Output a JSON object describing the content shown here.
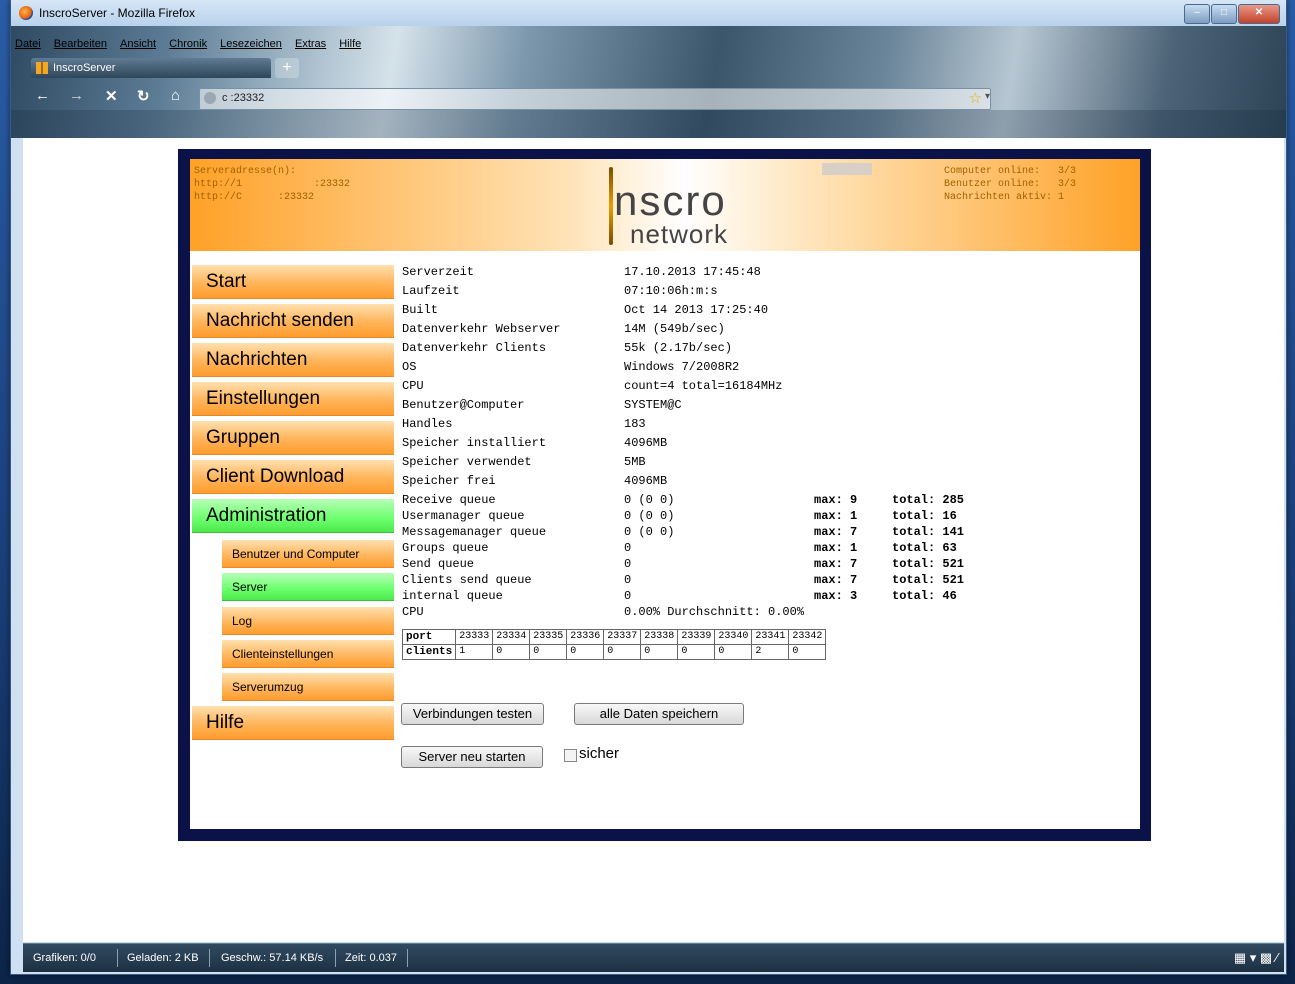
{
  "window": {
    "title": "InscroServer - Mozilla Firefox"
  },
  "menu": [
    "Datei",
    "Bearbeiten",
    "Ansicht",
    "Chronik",
    "Lesezeichen",
    "Extras",
    "Hilfe"
  ],
  "tab": {
    "label": "InscroServer",
    "new_tab": "+"
  },
  "urlbar": {
    "url": "c    :23332"
  },
  "header": {
    "left_lines": "Serveradresse(n):\nhttp://1            :23332\nhttp://C      :23332",
    "right_lines": "Computer online:   3/3\nBenutzer online:   3/3\nNachrichten aktiv: 1",
    "logo_line1": "nscro",
    "logo_line2": "network"
  },
  "nav": {
    "items": [
      {
        "label": "Start"
      },
      {
        "label": "Nachricht senden"
      },
      {
        "label": "Nachrichten"
      },
      {
        "label": "Einstellungen"
      },
      {
        "label": "Gruppen"
      },
      {
        "label": "Client Download"
      },
      {
        "label": "Administration"
      }
    ],
    "sub_items": [
      {
        "label": "Benutzer und Computer"
      },
      {
        "label": "Server"
      },
      {
        "label": "Log"
      },
      {
        "label": "Clienteinstellungen"
      },
      {
        "label": "Serverumzug"
      }
    ],
    "help": "Hilfe"
  },
  "info": [
    {
      "key": "Serverzeit",
      "value": "17.10.2013 17:45:48"
    },
    {
      "key": "Laufzeit",
      "value": "07:10:06h:m:s"
    },
    {
      "key": "Built",
      "value": "Oct 14 2013 17:25:40"
    },
    {
      "key": "Datenverkehr Webserver",
      "value": "14M (549b/sec)"
    },
    {
      "key": "Datenverkehr Clients",
      "value": "55k (2.17b/sec)"
    },
    {
      "key": "OS",
      "value": "Windows 7/2008R2"
    },
    {
      "key": "CPU",
      "value": "count=4 total=16184MHz"
    },
    {
      "key": "Benutzer@Computer",
      "value": "SYSTEM@C"
    },
    {
      "key": "Handles",
      "value": "183"
    },
    {
      "key": "Speicher installiert",
      "value": "4096MB"
    },
    {
      "key": "Speicher verwendet",
      "value": "5MB"
    },
    {
      "key": "Speicher frei",
      "value": "4096MB"
    }
  ],
  "queues": [
    {
      "key": "Receive queue",
      "value": "0 (0 0)",
      "max": "max: 9",
      "total": "total: 285"
    },
    {
      "key": "Usermanager queue",
      "value": "0 (0 0)",
      "max": "max: 1",
      "total": "total: 16"
    },
    {
      "key": "Messagemanager queue",
      "value": "0 (0 0)",
      "max": "max: 7",
      "total": "total: 141"
    },
    {
      "key": "Groups queue",
      "value": "0",
      "max": "max: 1",
      "total": "total: 63"
    },
    {
      "key": "Send queue",
      "value": "0",
      "max": "max: 7",
      "total": "total: 521"
    },
    {
      "key": "Clients send queue",
      "value": "0",
      "max": "max: 7",
      "total": "total: 521"
    },
    {
      "key": "internal queue",
      "value": "0",
      "max": "max: 3",
      "total": "total: 46"
    }
  ],
  "cpu_line": {
    "key": "CPU",
    "value": "0.00% Durchschnitt: 0.00%"
  },
  "ports": {
    "port_label": "port",
    "clients_label": "clients",
    "ports": [
      "23333",
      "23334",
      "23335",
      "23336",
      "23337",
      "23338",
      "23339",
      "23340",
      "23341",
      "23342"
    ],
    "clients": [
      "1",
      "0",
      "0",
      "0",
      "0",
      "0",
      "0",
      "0",
      "2",
      "0"
    ]
  },
  "buttons": {
    "test": "Verbindungen testen",
    "save_all": "alle Daten speichern",
    "restart": "Server neu starten",
    "sure_label": "sicher"
  },
  "statusbar": {
    "grafiken": "Grafiken: 0/0",
    "geladen": "Geladen: 2 KB",
    "geschw": "Geschw.: 57.14 KB/s",
    "zeit": "Zeit: 0.037"
  },
  "colors": {
    "menu_orange": "#ffb45a",
    "menu_active_green": "#6cff6c",
    "frame_navy": "#0b1247"
  }
}
